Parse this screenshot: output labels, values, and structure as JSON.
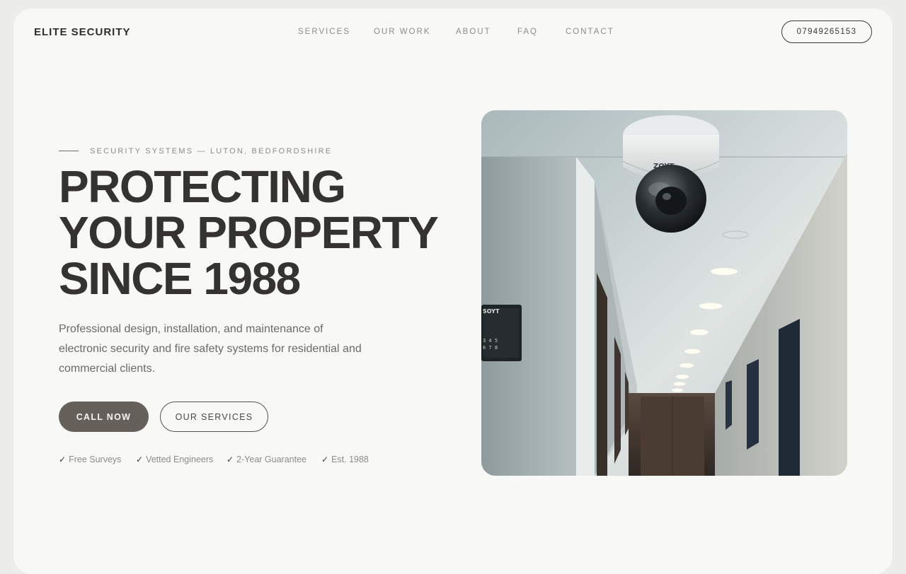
{
  "header": {
    "brand": "ELITE SECURITY",
    "nav": [
      {
        "label": "SERVICES"
      },
      {
        "label": "OUR WORK"
      },
      {
        "label": "ABOUT"
      },
      {
        "label": "FAQ"
      },
      {
        "label": "CONTACT"
      }
    ],
    "phone": "07949265153"
  },
  "hero": {
    "eyebrow": "SECURITY SYSTEMS — LUTON, BEDFORDSHIRE",
    "headline_lines": [
      "PROTECTING",
      "YOUR PROPERTY",
      "SINCE 1988"
    ],
    "description": "Professional design, installation, and maintenance of electronic security and fire safety systems for residential and commercial clients.",
    "primary_cta": "CALL NOW",
    "secondary_cta": "OUR SERVICES",
    "features": [
      {
        "check": "✓",
        "label": "Free Surveys"
      },
      {
        "check": "✓",
        "label": "Vetted Engineers"
      },
      {
        "check": "✓",
        "label": "2-Year Guarantee"
      },
      {
        "check": "✓",
        "label": "Est. 1988"
      }
    ],
    "image": {
      "subject": "ceiling-mounted dome CCTV camera in corridor",
      "camera_brand_mark": "ZOYT",
      "keypad_mark": "SOYT"
    }
  },
  "colors": {
    "page_bg": "#f8f8f6",
    "text_dark": "#34332f",
    "text_muted": "#8d8c88",
    "button_primary_bg": "#65605a"
  }
}
